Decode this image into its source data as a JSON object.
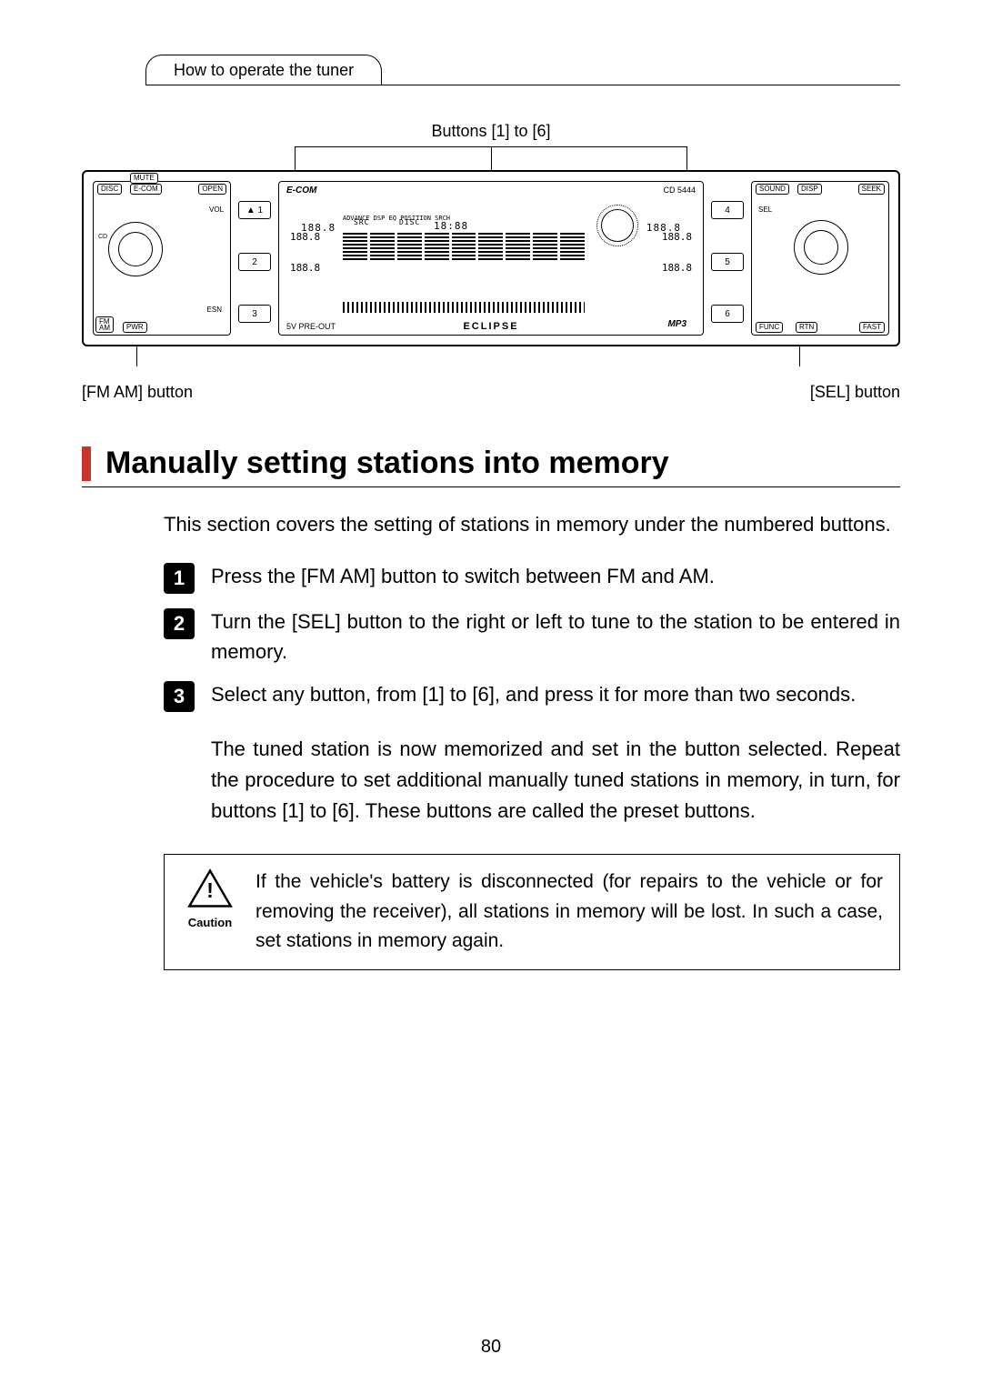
{
  "header": {
    "tab": "How to operate the tuner"
  },
  "diagram": {
    "top_label": "Buttons [1] to [6]",
    "left_label": "[FM AM] button",
    "right_label": "[SEL] button",
    "radio": {
      "brand": "E-COM",
      "model": "CD 5444",
      "eclipse": "ECLIPSE",
      "mp3": "MP3",
      "preout": "5V PRE-OUT",
      "left_buttons": {
        "mute": "MUTE",
        "disc": "DISC",
        "ecom": "E-COM",
        "open": "OPEN",
        "vol": "VOL",
        "esn": "ESN",
        "fmam": "FM\nAM",
        "pwr": "PWR",
        "cd": "CD"
      },
      "right_buttons": {
        "sound": "SOUND",
        "disp": "DISP",
        "seek": "SEEK",
        "sel": "SEL",
        "func": "FUNC",
        "rtn": "RTN",
        "fast": "FAST"
      },
      "presets_left": [
        "▲ 1",
        "2",
        "3"
      ],
      "presets_right": [
        "4",
        "5",
        "6"
      ],
      "lcd": {
        "src": "SRC",
        "disc": "DISC",
        "time": "18:88",
        "freq1": "188.8",
        "freq2": "188.8",
        "freq3": "188.8",
        "r1": "188.8",
        "r2": "188.8",
        "r3": "188.8",
        "tags": "ADVANCE  DSP  EQ  POSITION  SRCH"
      }
    }
  },
  "section": {
    "title": "Manually setting stations into memory",
    "intro": "This section covers the setting of stations in memory under the numbered buttons.",
    "steps": [
      "Press the [FM AM] button to switch between FM and AM.",
      "Turn the [SEL] button to the right or left to tune to the station to be entered in memory.",
      "Select any button, from [1] to [6], and press it for more than two seconds."
    ],
    "result": "The tuned station is now memorized and set in the button selected.  Repeat the procedure to set additional manually tuned stations in memory, in turn, for buttons [1] to [6].  These buttons are called the preset buttons.",
    "caution_label": "Caution",
    "caution_text": "If the vehicle's battery is disconnected (for repairs to the vehicle or for removing the receiver), all stations in memory will be lost. In such a case, set stations in memory again."
  },
  "page_number": "80"
}
